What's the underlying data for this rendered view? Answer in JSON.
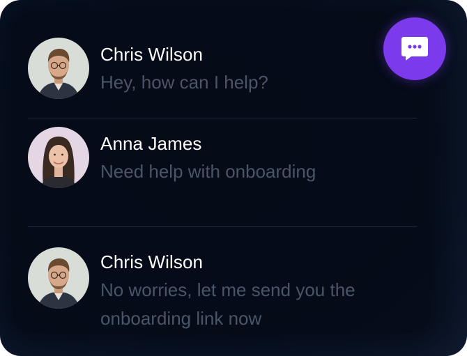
{
  "colors": {
    "background": "#081122",
    "accent": "#7c3aed",
    "name_text": "#ffffff",
    "message_text": "#4a5568"
  },
  "chat_button": {
    "icon": "chat-bubble-dots-icon"
  },
  "conversations": [
    {
      "name": "Chris Wilson",
      "message": "Hey, how can I help?",
      "avatar": "male-avatar"
    },
    {
      "name": "Anna James",
      "message": "Need help with onboarding",
      "avatar": "female-avatar"
    },
    {
      "name": "Chris Wilson",
      "message": "No worries, let me send you the onboarding link now",
      "avatar": "male-avatar"
    }
  ]
}
